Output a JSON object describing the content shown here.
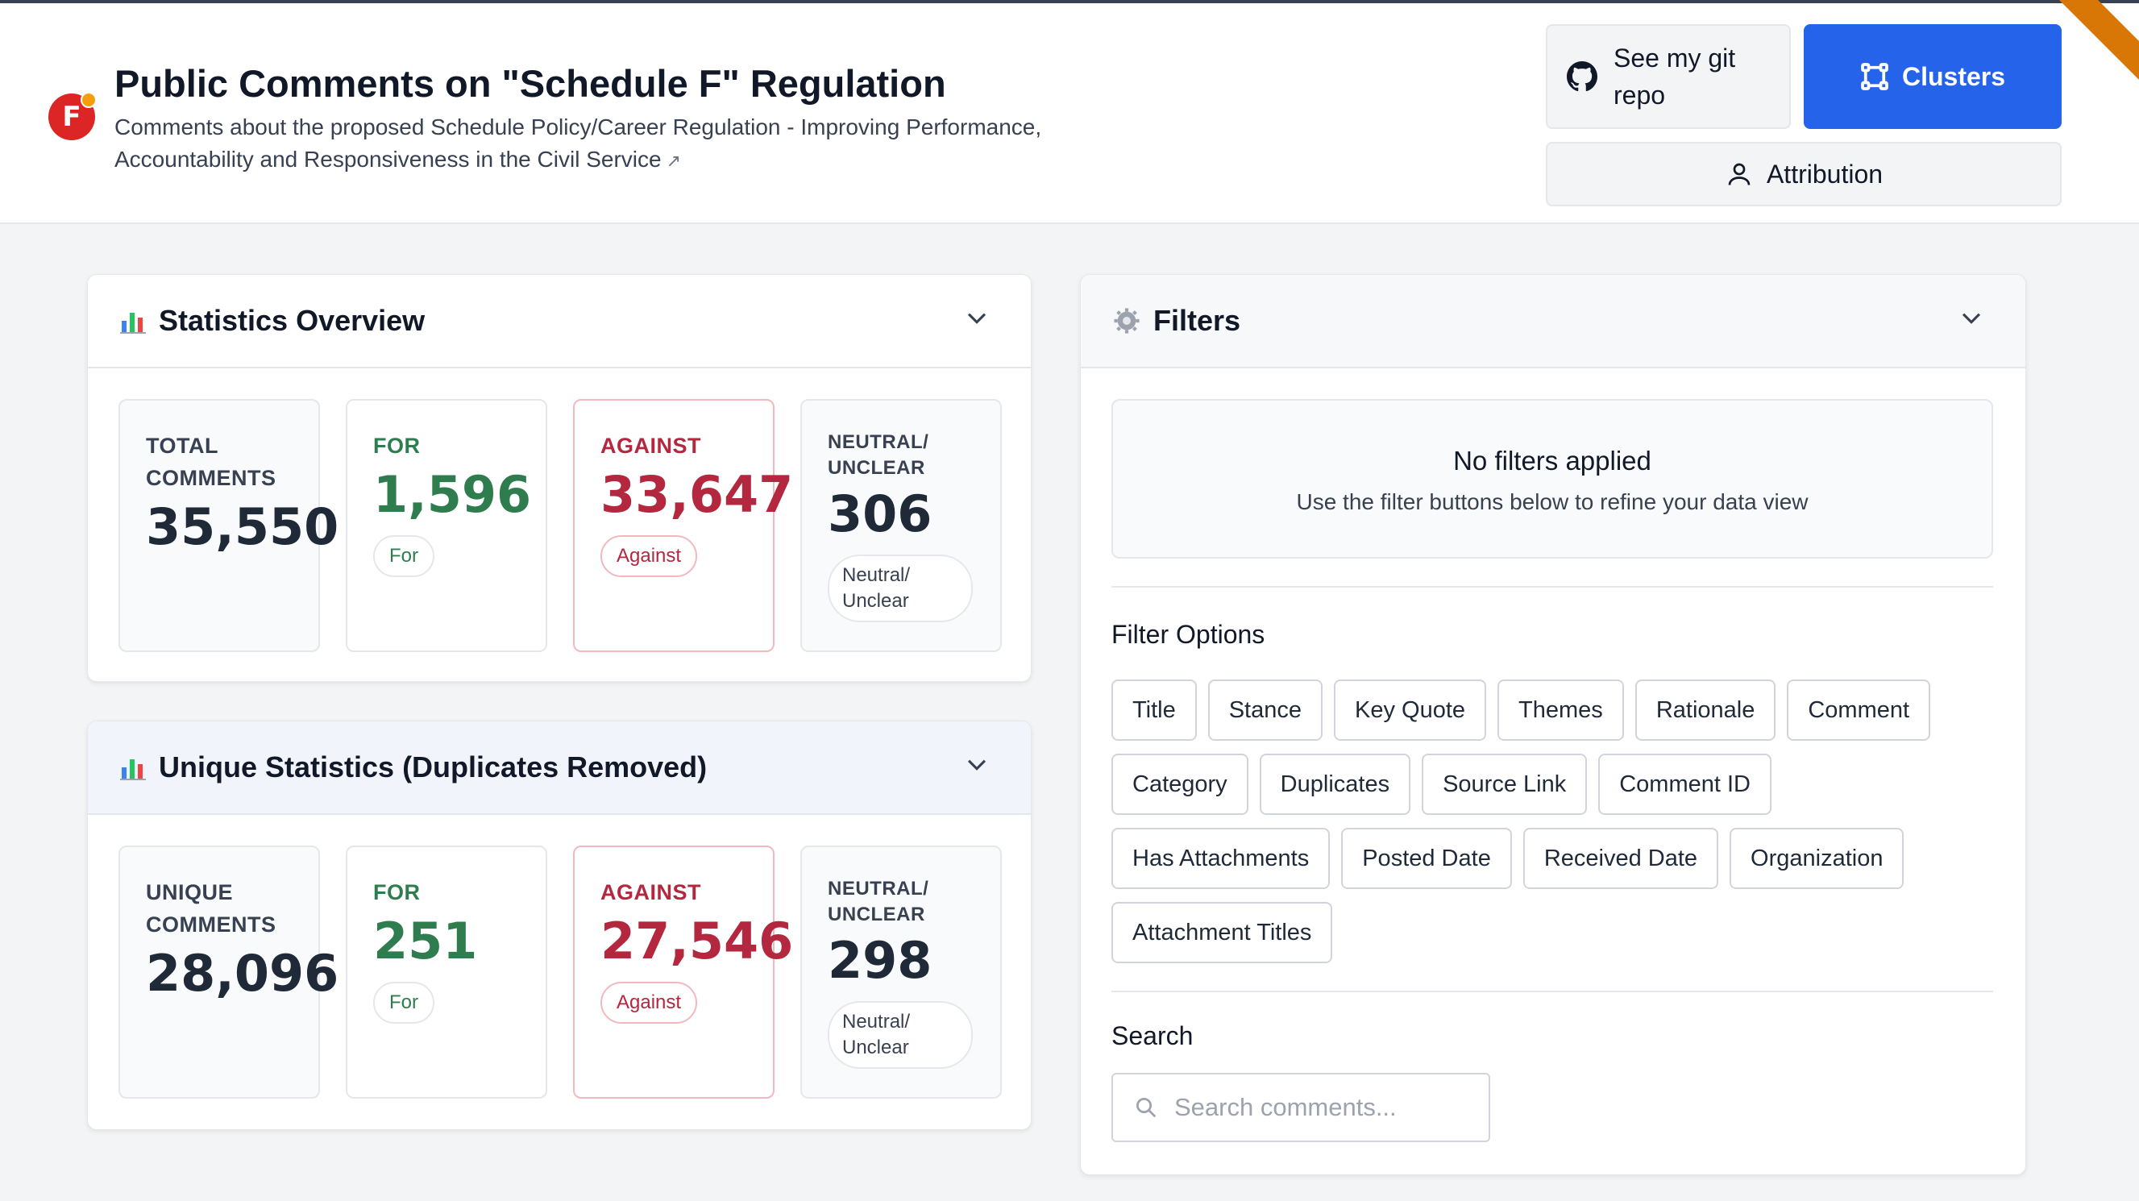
{
  "header": {
    "logo_letter": "F",
    "title": "Public Comments on \"Schedule F\" Regulation",
    "subtitle": "Comments about the proposed Schedule Policy/Career Regulation - Improving Performance, Accountability and Responsiveness in the Civil Service",
    "git_button": "See my git repo",
    "clusters_button": "Clusters",
    "attribution_button": "Attribution"
  },
  "stats": {
    "title": "Statistics Overview",
    "total_label": "TOTAL COMMENTS",
    "total_value": "35,550",
    "for_label": "FOR",
    "for_value": "1,596",
    "for_pill": "For",
    "against_label": "AGAINST",
    "against_value": "33,647",
    "against_pill": "Against",
    "neutral_label": "NEUTRAL/ UNCLEAR",
    "neutral_value": "306",
    "neutral_pill": "Neutral/ Unclear"
  },
  "unique": {
    "title": "Unique Statistics (Duplicates Removed)",
    "total_label": "UNIQUE COMMENTS",
    "total_value": "28,096",
    "for_label": "FOR",
    "for_value": "251",
    "for_pill": "For",
    "against_label": "AGAINST",
    "against_value": "27,546",
    "against_pill": "Against",
    "neutral_label": "NEUTRAL/ UNCLEAR",
    "neutral_value": "298",
    "neutral_pill": "Neutral/ Unclear"
  },
  "filters": {
    "title": "Filters",
    "empty_heading": "No filters applied",
    "empty_text": "Use the filter buttons below to refine your data view",
    "options_label": "Filter Options",
    "options": [
      "Title",
      "Stance",
      "Key Quote",
      "Themes",
      "Rationale",
      "Comment",
      "Category",
      "Duplicates",
      "Source Link",
      "Comment ID",
      "Has Attachments",
      "Posted Date",
      "Received Date",
      "Organization",
      "Attachment Titles"
    ],
    "search_label": "Search",
    "search_placeholder": "Search comments..."
  },
  "colors": {
    "primary": "#2563eb",
    "for": "#2f7d4f",
    "against": "#b4283f",
    "ribbon": "#d97706"
  }
}
